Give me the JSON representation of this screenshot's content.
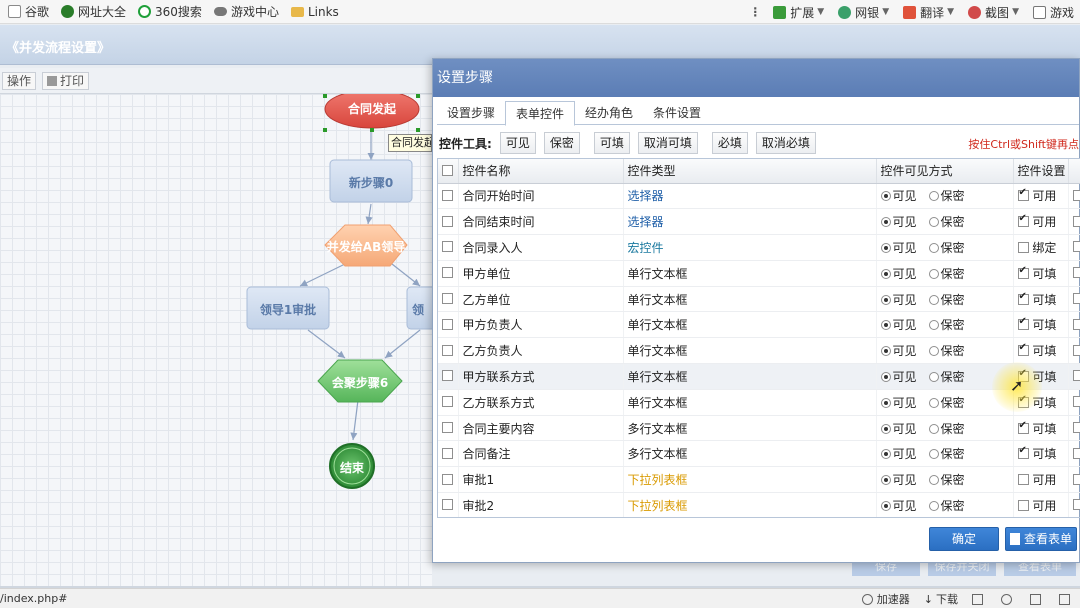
{
  "bookmarks": [
    {
      "label": "谷歌",
      "icon": "doc-icon",
      "color": "#8a8a8a"
    },
    {
      "label": "网址大全",
      "icon": "globe-icon",
      "color": "#2a7d2a"
    },
    {
      "label": "360搜索",
      "icon": "search360-icon",
      "color": "#1fa03a"
    },
    {
      "label": "游戏中心",
      "icon": "gamepad-icon",
      "color": "#666666"
    },
    {
      "label": "Links",
      "icon": "folder-icon",
      "color": "#e8b84a"
    }
  ],
  "browser_tools": [
    {
      "label": "扩展",
      "icon": "extension-icon"
    },
    {
      "label": "网银",
      "icon": "bank-icon"
    },
    {
      "label": "翻译",
      "icon": "translate-icon"
    },
    {
      "label": "截图",
      "icon": "scissors-icon"
    },
    {
      "label": "游戏",
      "icon": "game-icon"
    }
  ],
  "app": {
    "title": "《并发流程设置》",
    "toolbar": {
      "operate": "操作",
      "print": "打印"
    }
  },
  "flow": {
    "nodes": {
      "start": "合同发起",
      "step0": "新步骤0",
      "concurrent": "并发给AB领导",
      "leader1": "领导1审批",
      "leader2": "领",
      "merge": "会聚步骤6",
      "end": "结束"
    },
    "tooltip": "合同发起"
  },
  "modal": {
    "title": "设置步骤",
    "tabs": [
      "设置步骤",
      "表单控件",
      "经办角色",
      "条件设置"
    ],
    "active_tab": "表单控件",
    "tools_label": "控件工具:",
    "tool_buttons": [
      "可见",
      "保密",
      "可填",
      "取消可填",
      "必填",
      "取消必填"
    ],
    "tools_hint": "按住Ctrl或Shift键再点",
    "columns": [
      "控件名称",
      "控件类型",
      "控件可见方式",
      "控件设置"
    ],
    "vis_visible": "可见",
    "vis_secret": "保密",
    "rows": [
      {
        "name": "合同开始时间",
        "type": "选择器",
        "type_color": "blue",
        "visible": true,
        "setting": "可用",
        "setting_checked": true
      },
      {
        "name": "合同结束时间",
        "type": "选择器",
        "type_color": "blue",
        "visible": true,
        "setting": "可用",
        "setting_checked": true
      },
      {
        "name": "合同录入人",
        "type": "宏控件",
        "type_color": "teal",
        "visible": true,
        "setting": "绑定",
        "setting_checked": false
      },
      {
        "name": "甲方单位",
        "type": "单行文本框",
        "type_color": "plain",
        "visible": true,
        "setting": "可填",
        "setting_checked": true
      },
      {
        "name": "乙方单位",
        "type": "单行文本框",
        "type_color": "plain",
        "visible": true,
        "setting": "可填",
        "setting_checked": true
      },
      {
        "name": "甲方负责人",
        "type": "单行文本框",
        "type_color": "plain",
        "visible": true,
        "setting": "可填",
        "setting_checked": true
      },
      {
        "name": "乙方负责人",
        "type": "单行文本框",
        "type_color": "plain",
        "visible": true,
        "setting": "可填",
        "setting_checked": true
      },
      {
        "name": "甲方联系方式",
        "type": "单行文本框",
        "type_color": "plain",
        "visible": true,
        "setting": "可填",
        "setting_checked": true
      },
      {
        "name": "乙方联系方式",
        "type": "单行文本框",
        "type_color": "plain",
        "visible": true,
        "setting": "可填",
        "setting_checked": true
      },
      {
        "name": "合同主要内容",
        "type": "多行文本框",
        "type_color": "plain",
        "visible": true,
        "setting": "可填",
        "setting_checked": true
      },
      {
        "name": "合同备注",
        "type": "多行文本框",
        "type_color": "plain",
        "visible": true,
        "setting": "可填",
        "setting_checked": true
      },
      {
        "name": "审批1",
        "type": "下拉列表框",
        "type_color": "gold",
        "visible": true,
        "setting": "可用",
        "setting_checked": false
      },
      {
        "name": "审批2",
        "type": "下拉列表框",
        "type_color": "gold",
        "visible": true,
        "setting": "可用",
        "setting_checked": false
      }
    ],
    "confirm": "确定",
    "view_form": "查看表单"
  },
  "page_buttons": {
    "save": "保存",
    "save_concurrent": "保存并关闭",
    "view_form": "查看表单"
  },
  "status": {
    "url": "/index.php#",
    "accelerator": "加速器",
    "download": "下载"
  }
}
